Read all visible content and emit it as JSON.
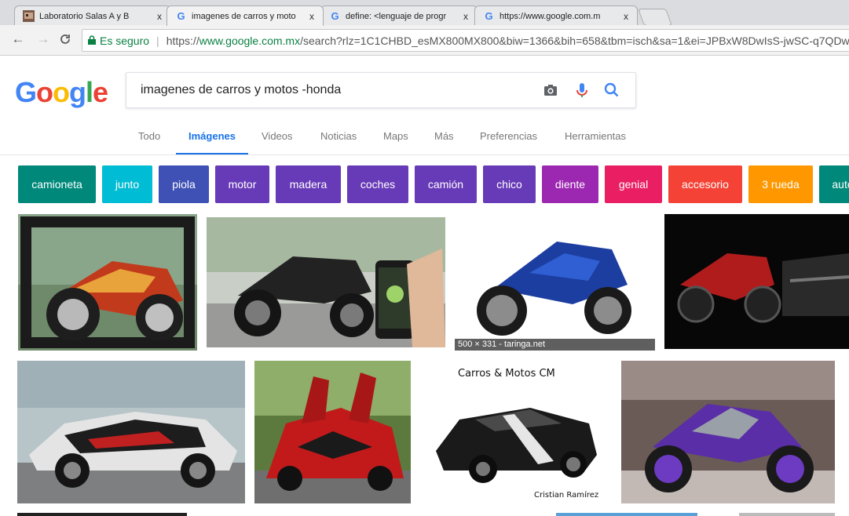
{
  "browser": {
    "tabs": [
      {
        "title": "Laboratorio Salas A y B",
        "close": "x"
      },
      {
        "title": "imagenes de carros y moto",
        "close": "x"
      },
      {
        "title": "define: <lenguaje de progr",
        "close": "x"
      },
      {
        "title": "https://www.google.com.m",
        "close": "x"
      }
    ],
    "secure_label": "Es seguro",
    "url_prefix": "https://",
    "url_host": "www.google.com.mx",
    "url_rest": "/search?rlz=1C1CHBD_esMX800MX800&biw=1366&bih=658&tbm=isch&sa=1&ei=JPBxW8DwIsS-jwSC-q7QDw"
  },
  "google": {
    "logo": [
      "G",
      "o",
      "o",
      "g",
      "l",
      "e"
    ],
    "logo_colors": [
      "#4285f4",
      "#ea4335",
      "#fbbc05",
      "#4285f4",
      "#34a853",
      "#ea4335"
    ],
    "query": "imagenes de carros y motos -honda"
  },
  "nav": {
    "tabs": [
      "Todo",
      "Imágenes",
      "Videos",
      "Noticias",
      "Maps",
      "Más",
      "Preferencias",
      "Herramientas"
    ]
  },
  "chips": [
    {
      "label": "camioneta",
      "color": "#00897b"
    },
    {
      "label": "junto",
      "color": "#00bcd4"
    },
    {
      "label": "piola",
      "color": "#3f51b5"
    },
    {
      "label": "motor",
      "color": "#673ab7"
    },
    {
      "label": "madera",
      "color": "#673ab7"
    },
    {
      "label": "coches",
      "color": "#673ab7"
    },
    {
      "label": "camión",
      "color": "#673ab7"
    },
    {
      "label": "chico",
      "color": "#673ab7"
    },
    {
      "label": "diente",
      "color": "#9c27b0"
    },
    {
      "label": "genial",
      "color": "#e91e63"
    },
    {
      "label": "accesorio",
      "color": "#f44336"
    },
    {
      "label": "3 rueda",
      "color": "#ff9800"
    },
    {
      "label": "auto",
      "color": "#00897b"
    }
  ],
  "results": {
    "hover_overlay": "500 × 331 - taringa.net",
    "caption_title": "Carros & Motos CM",
    "caption_credit": "Cristian Ramírez"
  }
}
